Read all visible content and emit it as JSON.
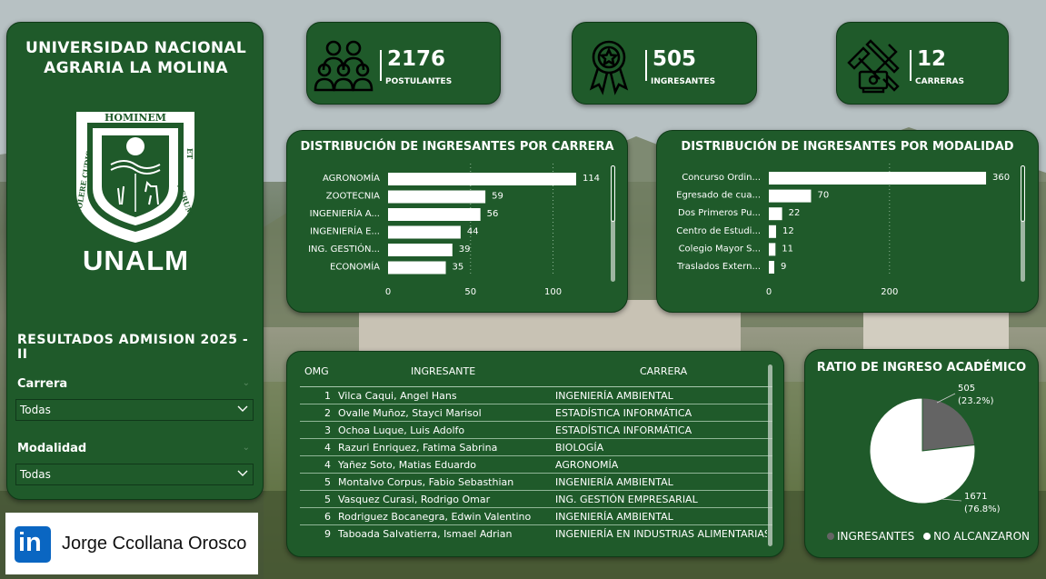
{
  "sidebar": {
    "title_line1": "UNIVERSIDAD NACIONAL",
    "title_line2": "AGRARIA LA MOLINA",
    "logo_text": "UNALM",
    "crest": {
      "top": "HOMINEM",
      "right_et": "ET",
      "right": "AGRUM",
      "left": "COLERE CUDIO"
    },
    "results_title": "RESULTADOS ADMISION 2025 - II",
    "filters": [
      {
        "label": "Carrera",
        "value": "Todas"
      },
      {
        "label": "Modalidad",
        "value": "Todas"
      }
    ]
  },
  "linkedin": {
    "icon": "linkedin-logo-icon",
    "icon_text": "in",
    "name": "Jorge Ccollana Orosco"
  },
  "kpis": [
    {
      "icon": "people-group-icon",
      "value": "2176",
      "label": "POSTULANTES"
    },
    {
      "icon": "award-ribbon-icon",
      "value": "505",
      "label": "INGRESANTES"
    },
    {
      "icon": "tools-icon",
      "value": "12",
      "label": "CARRERAS"
    }
  ],
  "colors": {
    "panel": "#1f5a2a",
    "pie_ingresantes": "#646464",
    "pie_no": "#ffffff"
  },
  "chart_data": [
    {
      "type": "bar",
      "orientation": "horizontal",
      "title": "DISTRIBUCIÓN DE INGRESANTES POR CARRERA",
      "categories": [
        "AGRONOMÍA",
        "ZOOTECNIA",
        "INGENIERÍA A...",
        "INGENIERÍA E...",
        "ING. GESTIÓN...",
        "ECONOMÍA"
      ],
      "values": [
        114,
        59,
        56,
        44,
        39,
        35
      ],
      "xticks": [
        "0",
        "50",
        "100"
      ],
      "xlim": [
        0,
        130
      ],
      "grid": true
    },
    {
      "type": "bar",
      "orientation": "horizontal",
      "title": "DISTRIBUCIÓN DE INGRESANTES POR MODALIDAD",
      "categories": [
        "Concurso Ordin...",
        "Egresado de cua...",
        "Dos Primeros Pu...",
        "Centro de Estudi...",
        "Colegio Mayor S...",
        "Traslados Extern..."
      ],
      "values": [
        360,
        70,
        22,
        12,
        11,
        9
      ],
      "xticks": [
        "0",
        "200"
      ],
      "xlim": [
        0,
        375
      ],
      "grid": true
    },
    {
      "type": "pie",
      "title": "RATIO DE INGRESO ACADÉMICO",
      "slices": [
        {
          "name": "INGRESANTES",
          "value": 505,
          "label": "505",
          "pct": "(23.2%)"
        },
        {
          "name": "NO ALCANZARON",
          "value": 1671,
          "label": "1671",
          "pct": "(76.8%)"
        }
      ],
      "legend_position": "bottom"
    }
  ],
  "table": {
    "headers": [
      "OMG",
      "INGRESANTE",
      "CARRERA"
    ],
    "rows": [
      [
        "1",
        "Vilca Caqui, Angel Hans",
        "INGENIERÍA AMBIENTAL"
      ],
      [
        "2",
        "Ovalle Muñoz, Stayci Marisol",
        "ESTADÍSTICA INFORMÁTICA"
      ],
      [
        "3",
        "Ochoa Luque, Luis Adolfo",
        "ESTADÍSTICA INFORMÁTICA"
      ],
      [
        "4",
        "Razuri Enriquez, Fatima Sabrina",
        "BIOLOGÍA"
      ],
      [
        "4",
        "Yañez Soto, Matias Eduardo",
        "AGRONOMÍA"
      ],
      [
        "5",
        "Montalvo Corpus, Fabio Sebasthian",
        "INGENIERÍA AMBIENTAL"
      ],
      [
        "5",
        "Vasquez Curasi, Rodrigo Omar",
        "ING. GESTIÓN EMPRESARIAL"
      ],
      [
        "6",
        "Rodriguez Bocanegra, Edwin Valentino",
        "INGENIERÍA AMBIENTAL"
      ],
      [
        "9",
        "Taboada Salvatierra, Ismael Adrian",
        "INGENIERÍA EN INDUSTRIAS ALIMENTARIAS"
      ]
    ]
  }
}
